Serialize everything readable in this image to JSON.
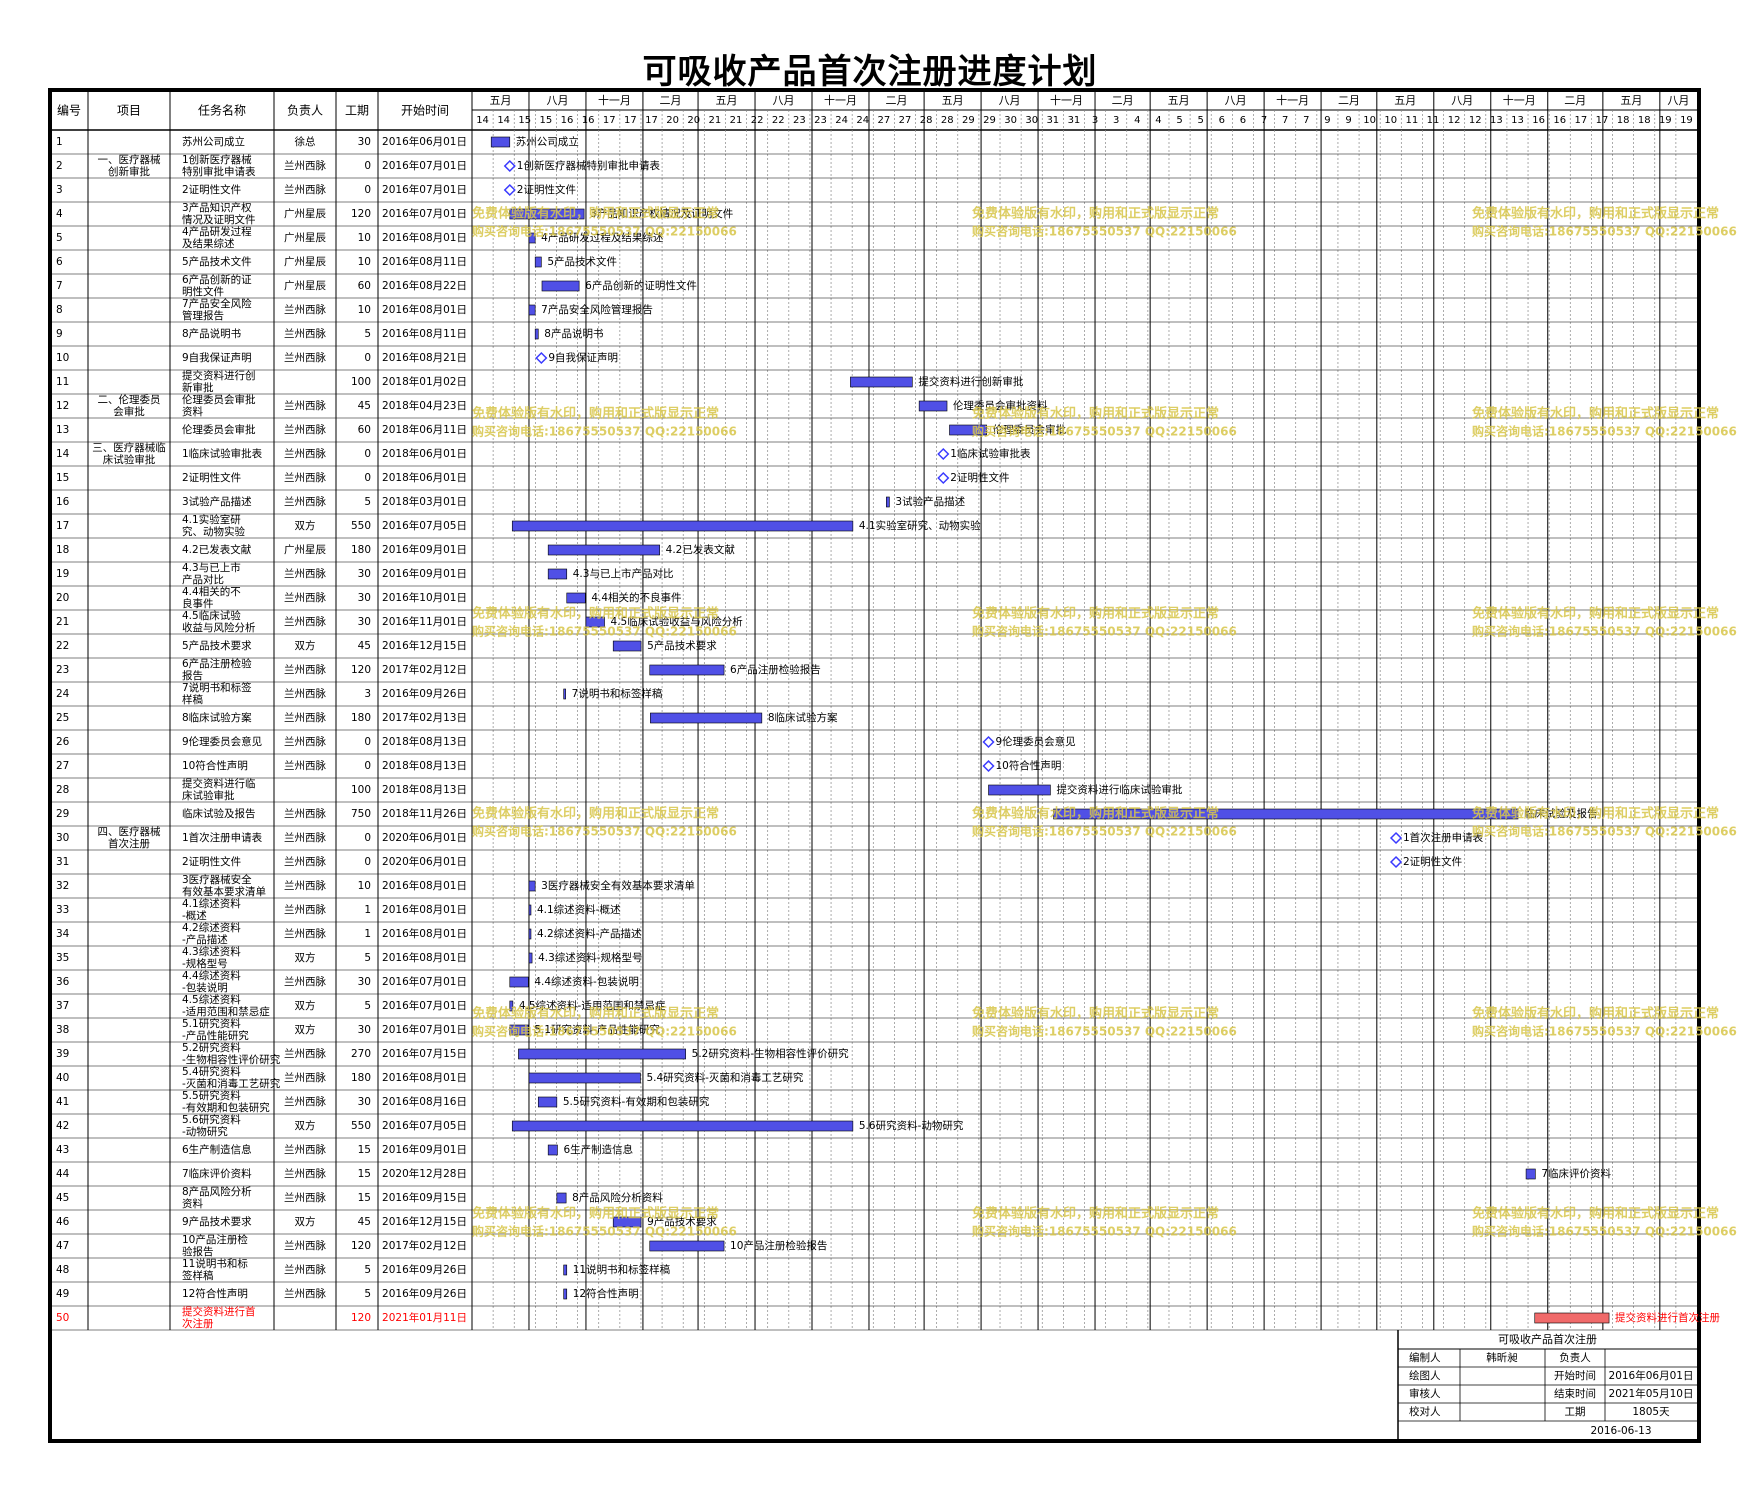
{
  "title": "可吸收产品首次注册进度计划",
  "table_headers": [
    "编号",
    "项目",
    "任务名称",
    "负责人",
    "工期",
    "开始时间"
  ],
  "timeline_header": {
    "top_labels": [
      "五月",
      "八月",
      "十一月",
      "二月",
      "五月",
      "八月",
      "十一月",
      "二月",
      "五月",
      "八月",
      "十一月",
      "二月",
      "五月",
      "八月",
      "十一月",
      "二月",
      "五月",
      "八月",
      "十一月",
      "二月",
      "五月",
      "八月"
    ],
    "bottom_labels": [
      "14",
      "14",
      "15",
      "15",
      "16",
      "16",
      "17",
      "17",
      "17",
      "20",
      "20",
      "21",
      "21",
      "22",
      "22",
      "23",
      "23",
      "24",
      "24",
      "27",
      "27",
      "28",
      "28",
      "29",
      "29",
      "30",
      "30",
      "31",
      "31",
      "3",
      "3",
      "4",
      "4",
      "5",
      "5",
      "6",
      "6",
      "7",
      "7",
      "7",
      "9",
      "9",
      "10",
      "10",
      "11",
      "11",
      "12",
      "12",
      "13",
      "13",
      "16",
      "16",
      "17",
      "17",
      "18",
      "18",
      "19",
      "19"
    ]
  },
  "watermark": {
    "line1": "免费体验版有水印，购用和正式版显示正常",
    "line2": "购买咨询电话:18675550537 QQ:22150066"
  },
  "info_box": {
    "title": "可吸收产品首次注册",
    "l1": "编制人",
    "v1": "韩昕昶",
    "r1": "负责人",
    "rv1": "",
    "l2": "绘图人",
    "v2": "",
    "r2": "开始时间",
    "rv2": "2016年06月01日",
    "l3": "审核人",
    "v3": "",
    "r3": "结束时间",
    "rv3": "2021年05月10日",
    "l4": "校对人",
    "v4": "",
    "r4": "工期",
    "rv4": "1805天",
    "date": "2016-06-13"
  },
  "colors": {
    "bar": "#5050e6",
    "bar_critical": "#f06a6a",
    "milestone": "#3a3aff",
    "watermark": "#d8c64a",
    "critical_text": "#ff0000"
  },
  "chart_data": {
    "type": "gantt",
    "x_axis": {
      "type": "date",
      "min": "2016-05-01",
      "max": "2021-09-30"
    },
    "rows": [
      {
        "no": "1",
        "project": "",
        "task": "苏州公司成立",
        "owner": "徐总",
        "duration": "30",
        "start": "2016年06月01日",
        "date": "2016-06-01",
        "days": 30,
        "kind": "bar",
        "label": "苏州公司成立"
      },
      {
        "no": "2",
        "project": "一、医疗器械创新审批",
        "task": "1创新医疗器械特别审批申请表",
        "owner": "兰州西脉",
        "duration": "0",
        "start": "2016年07月01日",
        "date": "2016-07-01",
        "days": 0,
        "kind": "milestone",
        "label": "1创新医疗器械特别审批申请表"
      },
      {
        "no": "3",
        "project": "",
        "task": "2证明性文件",
        "owner": "兰州西脉",
        "duration": "0",
        "start": "2016年07月01日",
        "date": "2016-07-01",
        "days": 0,
        "kind": "milestone",
        "label": "2证明性文件"
      },
      {
        "no": "4",
        "project": "",
        "task": "3产品知识产权情况及证明文件",
        "owner": "广州星辰",
        "duration": "120",
        "start": "2016年07月01日",
        "date": "2016-07-01",
        "days": 120,
        "kind": "bar",
        "label": "3产品知识产权情况及证明文件"
      },
      {
        "no": "5",
        "project": "",
        "task": "4产品研发过程及结果综述",
        "owner": "广州星辰",
        "duration": "10",
        "start": "2016年08月01日",
        "date": "2016-08-01",
        "days": 10,
        "kind": "bar",
        "label": "4产品研发过程及结果综述"
      },
      {
        "no": "6",
        "project": "",
        "task": "5产品技术文件",
        "owner": "广州星辰",
        "duration": "10",
        "start": "2016年08月11日",
        "date": "2016-08-11",
        "days": 10,
        "kind": "bar",
        "label": "5产品技术文件"
      },
      {
        "no": "7",
        "project": "",
        "task": "6产品创新的证明性文件",
        "owner": "广州星辰",
        "duration": "60",
        "start": "2016年08月22日",
        "date": "2016-08-22",
        "days": 60,
        "kind": "bar",
        "label": "6产品创新的证明性文件"
      },
      {
        "no": "8",
        "project": "",
        "task": "7产品安全风险管理报告",
        "owner": "兰州西脉",
        "duration": "10",
        "start": "2016年08月01日",
        "date": "2016-08-01",
        "days": 10,
        "kind": "bar",
        "label": "7产品安全风险管理报告"
      },
      {
        "no": "9",
        "project": "",
        "task": "8产品说明书",
        "owner": "兰州西脉",
        "duration": "5",
        "start": "2016年08月11日",
        "date": "2016-08-11",
        "days": 5,
        "kind": "bar",
        "label": "8产品说明书"
      },
      {
        "no": "10",
        "project": "",
        "task": "9自我保证声明",
        "owner": "兰州西脉",
        "duration": "0",
        "start": "2016年08月21日",
        "date": "2016-08-21",
        "days": 0,
        "kind": "milestone",
        "label": "9自我保证声明"
      },
      {
        "no": "11",
        "project": "",
        "task": "提交资料进行创新审批",
        "owner": "",
        "duration": "100",
        "start": "2018年01月02日",
        "date": "2018-01-02",
        "days": 100,
        "kind": "bar",
        "label": "提交资料进行创新审批"
      },
      {
        "no": "12",
        "project": "二、伦理委员会审批",
        "task": "伦理委员会审批资料",
        "owner": "兰州西脉",
        "duration": "45",
        "start": "2018年04月23日",
        "date": "2018-04-23",
        "days": 45,
        "kind": "bar",
        "label": "伦理委员会审批资料"
      },
      {
        "no": "13",
        "project": "",
        "task": "伦理委员会审批",
        "owner": "兰州西脉",
        "duration": "60",
        "start": "2018年06月11日",
        "date": "2018-06-11",
        "days": 60,
        "kind": "bar",
        "label": "伦理委员会审批"
      },
      {
        "no": "14",
        "project": "三、医疗器械临床试验审批",
        "task": "1临床试验审批表",
        "owner": "兰州西脉",
        "duration": "0",
        "start": "2018年06月01日",
        "date": "2018-06-01",
        "days": 0,
        "kind": "milestone",
        "label": "1临床试验审批表"
      },
      {
        "no": "15",
        "project": "",
        "task": "2证明性文件",
        "owner": "兰州西脉",
        "duration": "0",
        "start": "2018年06月01日",
        "date": "2018-06-01",
        "days": 0,
        "kind": "milestone",
        "label": "2证明性文件"
      },
      {
        "no": "16",
        "project": "",
        "task": "3试验产品描述",
        "owner": "兰州西脉",
        "duration": "5",
        "start": "2018年03月01日",
        "date": "2018-03-01",
        "days": 5,
        "kind": "bar",
        "label": "3试验产品描述"
      },
      {
        "no": "17",
        "project": "",
        "task": "4.1实验室研究、动物实验",
        "owner": "双方",
        "duration": "550",
        "start": "2016年07月05日",
        "date": "2016-07-05",
        "days": 550,
        "kind": "bar",
        "label": "4.1实验室研究、动物实验"
      },
      {
        "no": "18",
        "project": "",
        "task": "4.2已发表文献",
        "owner": "广州星辰",
        "duration": "180",
        "start": "2016年09月01日",
        "date": "2016-09-01",
        "days": 180,
        "kind": "bar",
        "label": "4.2已发表文献"
      },
      {
        "no": "19",
        "project": "",
        "task": "4.3与已上市产品对比",
        "owner": "兰州西脉",
        "duration": "30",
        "start": "2016年09月01日",
        "date": "2016-09-01",
        "days": 30,
        "kind": "bar",
        "label": "4.3与已上市产品对比"
      },
      {
        "no": "20",
        "project": "",
        "task": "4.4相关的不良事件",
        "owner": "兰州西脉",
        "duration": "30",
        "start": "2016年10月01日",
        "date": "2016-10-01",
        "days": 30,
        "kind": "bar",
        "label": "4.4相关的不良事件"
      },
      {
        "no": "21",
        "project": "",
        "task": "4.5临床试验收益与风险分析",
        "owner": "兰州西脉",
        "duration": "30",
        "start": "2016年11月01日",
        "date": "2016-11-01",
        "days": 30,
        "kind": "bar",
        "label": "4.5临床试验收益与风险分析"
      },
      {
        "no": "22",
        "project": "",
        "task": "5产品技术要求",
        "owner": "双方",
        "duration": "45",
        "start": "2016年12月15日",
        "date": "2016-12-15",
        "days": 45,
        "kind": "bar",
        "label": "5产品技术要求"
      },
      {
        "no": "23",
        "project": "",
        "task": "6产品注册检验报告",
        "owner": "兰州西脉",
        "duration": "120",
        "start": "2017年02月12日",
        "date": "2017-02-12",
        "days": 120,
        "kind": "bar",
        "label": "6产品注册检验报告"
      },
      {
        "no": "24",
        "project": "",
        "task": "7说明书和标签样稿",
        "owner": "兰州西脉",
        "duration": "3",
        "start": "2016年09月26日",
        "date": "2016-09-26",
        "days": 3,
        "kind": "bar",
        "label": "7说明书和标签样稿"
      },
      {
        "no": "25",
        "project": "",
        "task": "8临床试验方案",
        "owner": "兰州西脉",
        "duration": "180",
        "start": "2017年02月13日",
        "date": "2017-02-13",
        "days": 180,
        "kind": "bar",
        "label": "8临床试验方案"
      },
      {
        "no": "26",
        "project": "",
        "task": "9伦理委员会意见",
        "owner": "兰州西脉",
        "duration": "0",
        "start": "2018年08月13日",
        "date": "2018-08-13",
        "days": 0,
        "kind": "milestone",
        "label": "9伦理委员会意见"
      },
      {
        "no": "27",
        "project": "",
        "task": "10符合性声明",
        "owner": "兰州西脉",
        "duration": "0",
        "start": "2018年08月13日",
        "date": "2018-08-13",
        "days": 0,
        "kind": "milestone",
        "label": "10符合性声明"
      },
      {
        "no": "28",
        "project": "",
        "task": "提交资料进行临床试验审批",
        "owner": "",
        "duration": "100",
        "start": "2018年08月13日",
        "date": "2018-08-13",
        "days": 100,
        "kind": "bar",
        "label": "提交资料进行临床试验审批"
      },
      {
        "no": "29",
        "project": "",
        "task": "临床试验及报告",
        "owner": "兰州西脉",
        "duration": "750",
        "start": "2018年11月26日",
        "date": "2018-11-26",
        "days": 750,
        "kind": "bar",
        "label": "临床试验及报告"
      },
      {
        "no": "30",
        "project": "四、医疗器械首次注册",
        "task": "1首次注册申请表",
        "owner": "兰州西脉",
        "duration": "0",
        "start": "2020年06月01日",
        "date": "2020-06-01",
        "days": 0,
        "kind": "milestone",
        "label": "1首次注册申请表"
      },
      {
        "no": "31",
        "project": "",
        "task": "2证明性文件",
        "owner": "兰州西脉",
        "duration": "0",
        "start": "2020年06月01日",
        "date": "2020-06-01",
        "days": 0,
        "kind": "milestone",
        "label": "2证明性文件"
      },
      {
        "no": "32",
        "project": "",
        "task": "3医疗器械安全有效基本要求清单",
        "owner": "兰州西脉",
        "duration": "10",
        "start": "2016年08月01日",
        "date": "2016-08-01",
        "days": 10,
        "kind": "bar",
        "label": "3医疗器械安全有效基本要求清单"
      },
      {
        "no": "33",
        "project": "",
        "task": "4.1综述资料-概述",
        "owner": "兰州西脉",
        "duration": "1",
        "start": "2016年08月01日",
        "date": "2016-08-01",
        "days": 1,
        "kind": "bar",
        "label": "4.1综述资料-概述"
      },
      {
        "no": "34",
        "project": "",
        "task": "4.2综述资料-产品描述",
        "owner": "兰州西脉",
        "duration": "1",
        "start": "2016年08月01日",
        "date": "2016-08-01",
        "days": 1,
        "kind": "bar",
        "label": "4.2综述资料-产品描述"
      },
      {
        "no": "35",
        "project": "",
        "task": "4.3综述资料-规格型号",
        "owner": "双方",
        "duration": "5",
        "start": "2016年08月01日",
        "date": "2016-08-01",
        "days": 5,
        "kind": "bar",
        "label": "4.3综述资料-规格型号"
      },
      {
        "no": "36",
        "project": "",
        "task": "4.4综述资料-包装说明",
        "owner": "兰州西脉",
        "duration": "30",
        "start": "2016年07月01日",
        "date": "2016-07-01",
        "days": 30,
        "kind": "bar",
        "label": "4.4综述资料-包装说明"
      },
      {
        "no": "37",
        "project": "",
        "task": "4.5综述资料-适用范围和禁忌症",
        "owner": "双方",
        "duration": "5",
        "start": "2016年07月01日",
        "date": "2016-07-01",
        "days": 5,
        "kind": "bar",
        "label": "4.5综述资料-适用范围和禁忌症"
      },
      {
        "no": "38",
        "project": "",
        "task": "5.1研究资料-产品性能研究",
        "owner": "双方",
        "duration": "30",
        "start": "2016年07月01日",
        "date": "2016-07-01",
        "days": 30,
        "kind": "bar",
        "label": "5.1研究资料-产品性能研究"
      },
      {
        "no": "39",
        "project": "",
        "task": "5.2研究资料-生物相容性评价研究",
        "owner": "兰州西脉",
        "duration": "270",
        "start": "2016年07月15日",
        "date": "2016-07-15",
        "days": 270,
        "kind": "bar",
        "label": "5.2研究资料-生物相容性评价研究"
      },
      {
        "no": "40",
        "project": "",
        "task": "5.4研究资料-灭菌和消毒工艺研究",
        "owner": "兰州西脉",
        "duration": "180",
        "start": "2016年08月01日",
        "date": "2016-08-01",
        "days": 180,
        "kind": "bar",
        "label": "5.4研究资料-灭菌和消毒工艺研究"
      },
      {
        "no": "41",
        "project": "",
        "task": "5.5研究资料-有效期和包装研究",
        "owner": "兰州西脉",
        "duration": "30",
        "start": "2016年08月16日",
        "date": "2016-08-16",
        "days": 30,
        "kind": "bar",
        "label": "5.5研究资料-有效期和包装研究"
      },
      {
        "no": "42",
        "project": "",
        "task": "5.6研究资料-动物研究",
        "owner": "双方",
        "duration": "550",
        "start": "2016年07月05日",
        "date": "2016-07-05",
        "days": 550,
        "kind": "bar",
        "label": "5.6研究资料-动物研究"
      },
      {
        "no": "43",
        "project": "",
        "task": "6生产制造信息",
        "owner": "兰州西脉",
        "duration": "15",
        "start": "2016年09月01日",
        "date": "2016-09-01",
        "days": 15,
        "kind": "bar",
        "label": "6生产制造信息"
      },
      {
        "no": "44",
        "project": "",
        "task": "7临床评价资料",
        "owner": "兰州西脉",
        "duration": "15",
        "start": "2020年12月28日",
        "date": "2020-12-28",
        "days": 15,
        "kind": "bar",
        "label": "7临床评价资料"
      },
      {
        "no": "45",
        "project": "",
        "task": "8产品风险分析资料",
        "owner": "兰州西脉",
        "duration": "15",
        "start": "2016年09月15日",
        "date": "2016-09-15",
        "days": 15,
        "kind": "bar",
        "label": "8产品风险分析资料"
      },
      {
        "no": "46",
        "project": "",
        "task": "9产品技术要求",
        "owner": "双方",
        "duration": "45",
        "start": "2016年12月15日",
        "date": "2016-12-15",
        "days": 45,
        "kind": "bar",
        "label": "9产品技术要求"
      },
      {
        "no": "47",
        "project": "",
        "task": "10产品注册检验报告",
        "owner": "兰州西脉",
        "duration": "120",
        "start": "2017年02月12日",
        "date": "2017-02-12",
        "days": 120,
        "kind": "bar",
        "label": "10产品注册检验报告"
      },
      {
        "no": "48",
        "project": "",
        "task": "11说明书和标签样稿",
        "owner": "兰州西脉",
        "duration": "5",
        "start": "2016年09月26日",
        "date": "2016-09-26",
        "days": 5,
        "kind": "bar",
        "label": "11说明书和标签样稿"
      },
      {
        "no": "49",
        "project": "",
        "task": "12符合性声明",
        "owner": "兰州西脉",
        "duration": "5",
        "start": "2016年09月26日",
        "date": "2016-09-26",
        "days": 5,
        "kind": "bar",
        "label": "12符合性声明"
      },
      {
        "no": "50",
        "project": "",
        "task": "提交资料进行首次注册",
        "owner": "",
        "duration": "120",
        "start": "2021年01月11日",
        "date": "2021-01-11",
        "days": 120,
        "kind": "bar",
        "label": "提交资料进行首次注册",
        "critical": true
      }
    ]
  }
}
